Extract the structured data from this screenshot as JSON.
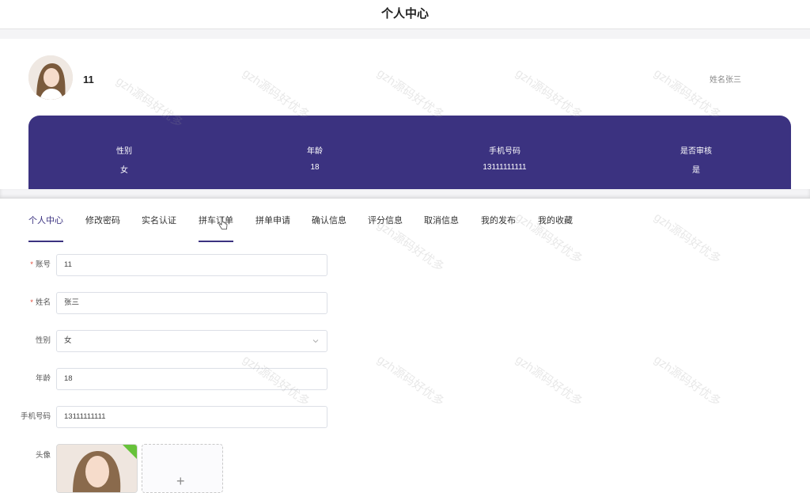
{
  "header": {
    "title": "个人中心"
  },
  "profile": {
    "username": "11",
    "realname_label": "姓名张三",
    "info": [
      {
        "label": "性别",
        "value": "女"
      },
      {
        "label": "年龄",
        "value": "18"
      },
      {
        "label": "手机号码",
        "value": "13111111111"
      },
      {
        "label": "是否审核",
        "value": "是"
      }
    ]
  },
  "tabs": [
    {
      "label": "个人中心",
      "state": "active"
    },
    {
      "label": "修改密码"
    },
    {
      "label": "实名认证"
    },
    {
      "label": "拼车订单",
      "state": "hover"
    },
    {
      "label": "拼单申请"
    },
    {
      "label": "确认信息"
    },
    {
      "label": "评分信息"
    },
    {
      "label": "取消信息"
    },
    {
      "label": "我的发布"
    },
    {
      "label": "我的收藏"
    }
  ],
  "form": {
    "account": {
      "label": "账号",
      "value": "11"
    },
    "name": {
      "label": "姓名",
      "value": "张三"
    },
    "gender": {
      "label": "性别",
      "value": "女"
    },
    "age": {
      "label": "年龄",
      "value": "18"
    },
    "phone": {
      "label": "手机号码",
      "value": "13111111111"
    },
    "avatar": {
      "label": "头像",
      "add": "+"
    }
  },
  "watermark": "gzh源码好优多",
  "colors": {
    "primary": "#3b3280",
    "required": "#e04a3a",
    "success": "#67c23a"
  }
}
